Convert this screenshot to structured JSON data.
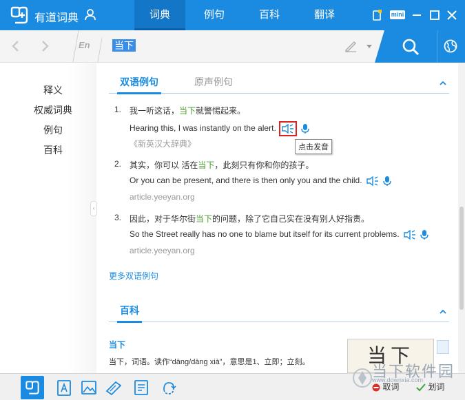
{
  "app": {
    "title": "有道词典"
  },
  "nav": {
    "tabs": [
      {
        "label": "词典",
        "active": true
      },
      {
        "label": "例句",
        "active": false
      },
      {
        "label": "百科",
        "active": false
      },
      {
        "label": "翻译",
        "active": false
      }
    ]
  },
  "window": {
    "mini_label": "mini"
  },
  "search": {
    "lang_label": "En",
    "query": "当下"
  },
  "sidebar": {
    "items": [
      {
        "label": "释义"
      },
      {
        "label": "权威词典"
      },
      {
        "label": "例句"
      },
      {
        "label": "百科"
      }
    ]
  },
  "examples_section": {
    "tab_active": "双语例句",
    "tab_inactive": "原声例句",
    "items": [
      {
        "num": "1.",
        "cn_before": "我一听这话，",
        "cn_highlight": "当下",
        "cn_after": "就警惕起来。",
        "en": "Hearing this, I was instantly on the alert.",
        "source": "《新英汉大辞典》"
      },
      {
        "num": "2.",
        "cn_before": "其实，你可以 活在",
        "cn_highlight": "当下",
        "cn_after": "，此刻只有你和你的孩子。",
        "en": "Or you can be present, and there is then only you and the child.",
        "source": "article.yeeyan.org"
      },
      {
        "num": "3.",
        "cn_before": "因此，对于华尔街",
        "cn_highlight": "当下",
        "cn_after": "的问题，除了它自己实在没有别人好指责。",
        "en": "So the Street really has no one to blame but itself for its current problems.",
        "source": "article.yeeyan.org"
      }
    ],
    "tooltip": "点击发音",
    "more_link": "更多双语例句"
  },
  "baike_section": {
    "title": "百科",
    "term": "当下",
    "description": "当下，词语。读作“dāng/dàng xià”，意思是1、立即；立刻。",
    "image_text": "当下"
  },
  "bottom": {
    "cancel_label": "取词",
    "select_label": "划词"
  },
  "watermark": {
    "line1": "当下软件园",
    "line2": "www.downxia.com"
  },
  "colors": {
    "accent": "#1a8be0",
    "highlight": "#4a9a2a",
    "alert": "#e0201c"
  }
}
